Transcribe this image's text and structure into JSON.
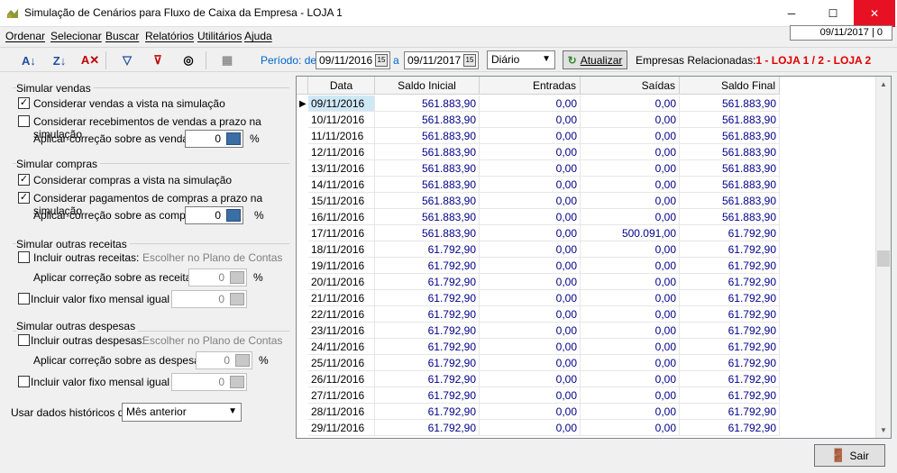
{
  "window": {
    "title": "Simulação de Cenários para Fluxo de Caixa da Empresa - LOJA 1",
    "minimize_glyph": "─",
    "maximize_glyph": "☐",
    "close_glyph": "✕"
  },
  "menu": {
    "items": [
      "Ordenar",
      "Selecionar",
      "Buscar",
      "Relatórios",
      "Utilitários",
      "Ajuda"
    ],
    "date_status": "09/11/2017 | 0"
  },
  "toolbar": {
    "period_label": "Período: de",
    "date_from": "09/11/2016",
    "a_label": "a",
    "date_to": "09/11/2017",
    "frequency": "Diário",
    "refresh_label": "Atualizar",
    "companies_label": "Empresas Relacionadas:",
    "companies_value": "1 - LOJA 1 / 2 - LOJA 2",
    "cal_glyph": "15"
  },
  "sales": {
    "title": "Simular vendas",
    "check1": "Considerar vendas a vista na simulação",
    "check1_checked": true,
    "check2": "Considerar recebimentos de vendas a prazo na simulação",
    "check2_checked": false,
    "correction_label": "Aplicar correção sobre as vendas:",
    "correction_value": "0",
    "percent": "%"
  },
  "purchases": {
    "title": "Simular compras",
    "check1": "Considerar compras a vista na simulação",
    "check1_checked": true,
    "check2": "Considerar pagamentos de compras a prazo na simulação",
    "check2_checked": true,
    "correction_label": "Aplicar correção sobre as compras:",
    "correction_value": "0",
    "percent": "%"
  },
  "other_income": {
    "title": "Simular outras receitas",
    "include_label": "Incluir outras receitas:",
    "chart_link": "Escolher no Plano de Contas",
    "correction_label": "Aplicar correção sobre as receitas:",
    "correction_value": "0",
    "percent": "%",
    "fixed_label": "Incluir valor fixo mensal igual a:",
    "fixed_value": "0"
  },
  "other_expenses": {
    "title": "Simular outras despesas",
    "include_label": "Incluir outras despesas:",
    "chart_link": "Escolher no Plano de Contas",
    "correction_label": "Aplicar correção sobre as despesas:",
    "correction_value": "0",
    "percent": "%",
    "fixed_label": "Incluir valor fixo mensal igual a:",
    "fixed_value": "0"
  },
  "history": {
    "label": "Usar dados históricos de:",
    "value": "Mês anterior"
  },
  "grid": {
    "columns": [
      "Data",
      "Saldo Inicial",
      "Entradas",
      "Saídas",
      "Saldo Final"
    ],
    "rows": [
      [
        "09/11/2016",
        "561.883,90",
        "0,00",
        "0,00",
        "561.883,90"
      ],
      [
        "10/11/2016",
        "561.883,90",
        "0,00",
        "0,00",
        "561.883,90"
      ],
      [
        "11/11/2016",
        "561.883,90",
        "0,00",
        "0,00",
        "561.883,90"
      ],
      [
        "12/11/2016",
        "561.883,90",
        "0,00",
        "0,00",
        "561.883,90"
      ],
      [
        "13/11/2016",
        "561.883,90",
        "0,00",
        "0,00",
        "561.883,90"
      ],
      [
        "14/11/2016",
        "561.883,90",
        "0,00",
        "0,00",
        "561.883,90"
      ],
      [
        "15/11/2016",
        "561.883,90",
        "0,00",
        "0,00",
        "561.883,90"
      ],
      [
        "16/11/2016",
        "561.883,90",
        "0,00",
        "0,00",
        "561.883,90"
      ],
      [
        "17/11/2016",
        "561.883,90",
        "0,00",
        "500.091,00",
        "61.792,90"
      ],
      [
        "18/11/2016",
        "61.792,90",
        "0,00",
        "0,00",
        "61.792,90"
      ],
      [
        "19/11/2016",
        "61.792,90",
        "0,00",
        "0,00",
        "61.792,90"
      ],
      [
        "20/11/2016",
        "61.792,90",
        "0,00",
        "0,00",
        "61.792,90"
      ],
      [
        "21/11/2016",
        "61.792,90",
        "0,00",
        "0,00",
        "61.792,90"
      ],
      [
        "22/11/2016",
        "61.792,90",
        "0,00",
        "0,00",
        "61.792,90"
      ],
      [
        "23/11/2016",
        "61.792,90",
        "0,00",
        "0,00",
        "61.792,90"
      ],
      [
        "24/11/2016",
        "61.792,90",
        "0,00",
        "0,00",
        "61.792,90"
      ],
      [
        "25/11/2016",
        "61.792,90",
        "0,00",
        "0,00",
        "61.792,90"
      ],
      [
        "26/11/2016",
        "61.792,90",
        "0,00",
        "0,00",
        "61.792,90"
      ],
      [
        "27/11/2016",
        "61.792,90",
        "0,00",
        "0,00",
        "61.792,90"
      ],
      [
        "28/11/2016",
        "61.792,90",
        "0,00",
        "0,00",
        "61.792,90"
      ],
      [
        "29/11/2016",
        "61.792,90",
        "0,00",
        "0,00",
        "61.792,90"
      ]
    ]
  },
  "footer": {
    "exit_label": "Sair"
  }
}
